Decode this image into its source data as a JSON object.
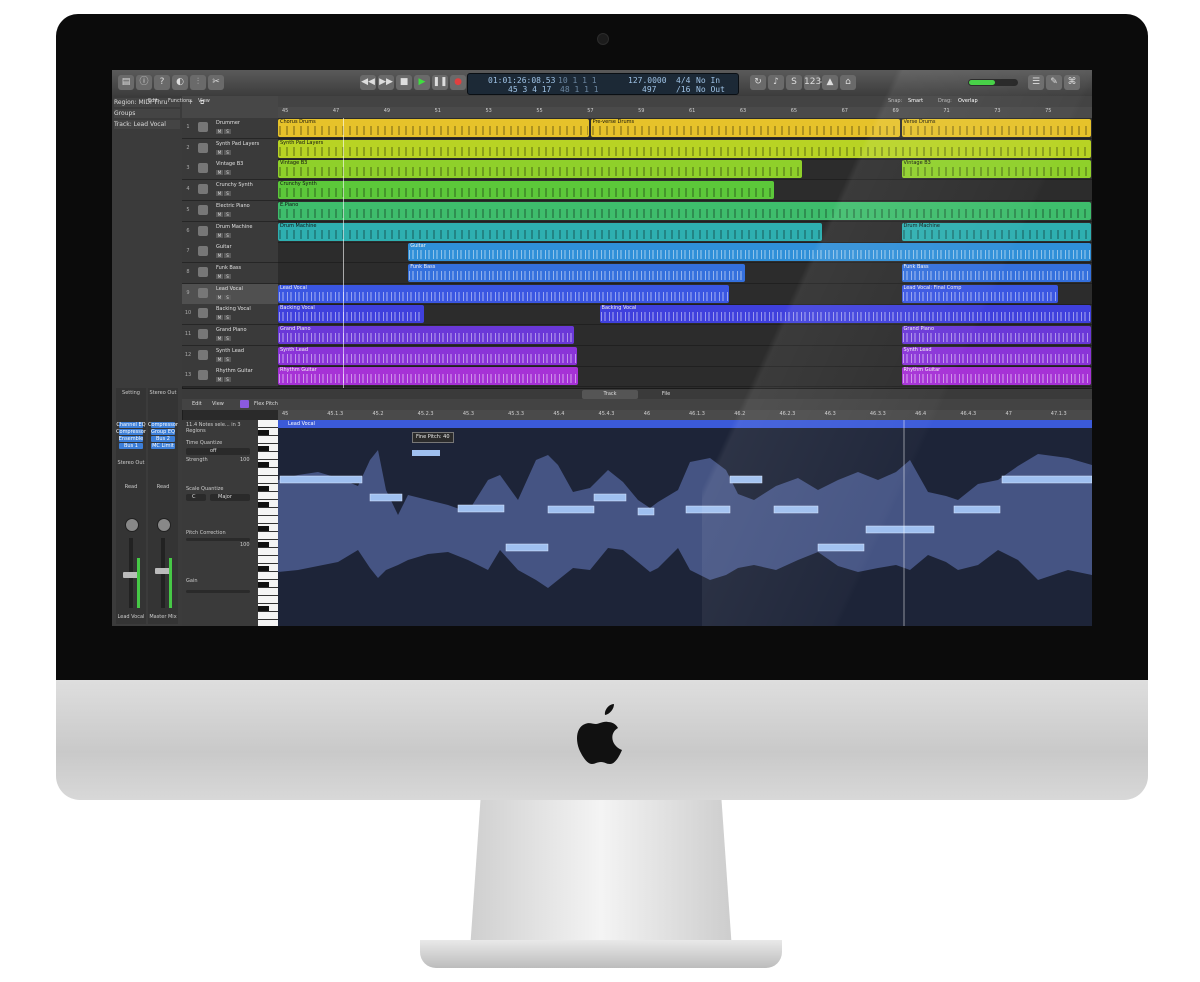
{
  "toolbar": {
    "lcd_position": "01:01:26:08.53",
    "lcd_bars": "10  1  1  1",
    "lcd_bars_row2": "45  3  4  17",
    "lcd_sub_row2": "48  1  1  1",
    "lcd_tempo": "127.0000",
    "lcd_sig": "4/4",
    "lcd_sig_row2": "/16",
    "lcd_key_row2": "497",
    "lcd_in": "No In",
    "lcd_out": "No Out"
  },
  "inspector": {
    "region_label": "Region: MIDI Thru",
    "groups_label": "Groups",
    "track_label": "Track: Lead Vocal",
    "strip_left": {
      "top": "Setting",
      "plugins": [
        "Channel EQ",
        "Compressor",
        "Ensemble",
        "Bus 1"
      ],
      "stereo": "Stereo Out",
      "read": "Read",
      "bottom": "Lead Vocal"
    },
    "strip_right": {
      "top": "Stereo Out",
      "plugins": [
        "Compressor",
        "Group EQ",
        "Bus 2",
        "MC Limit"
      ],
      "read": "Read",
      "bottom": "Master Mix"
    }
  },
  "arrange": {
    "menus": [
      "Edit",
      "Functions",
      "View"
    ],
    "snap_label": "Snap:",
    "snap_value": "Smart",
    "drag_label": "Drag:",
    "drag_value": "Overlap",
    "ruler": [
      "45",
      "47",
      "49",
      "51",
      "53",
      "55",
      "57",
      "59",
      "61",
      "63",
      "65",
      "67",
      "69",
      "71",
      "73",
      "75"
    ]
  },
  "tracks": [
    {
      "num": "1",
      "name": "Drummer",
      "color": "#e6c22a"
    },
    {
      "num": "2",
      "name": "Synth Pad Layers",
      "color": "#b8d324"
    },
    {
      "num": "3",
      "name": "Vintage B3",
      "color": "#8fd02a"
    },
    {
      "num": "4",
      "name": "Crunchy Synth",
      "color": "#5cc83a"
    },
    {
      "num": "5",
      "name": "Electric Piano",
      "color": "#3ebd6c"
    },
    {
      "num": "6",
      "name": "Drum Machine",
      "color": "#2eafb0"
    },
    {
      "num": "7",
      "name": "Guitar",
      "color": "#2f8fd8"
    },
    {
      "num": "8",
      "name": "Funk Bass",
      "color": "#3470dd"
    },
    {
      "num": "9",
      "name": "Lead Vocal",
      "color": "#3a56e2"
    },
    {
      "num": "10",
      "name": "Backing Vocal",
      "color": "#3f40dd"
    },
    {
      "num": "11",
      "name": "Grand Piano",
      "color": "#6a38d8"
    },
    {
      "num": "12",
      "name": "Synth Lead",
      "color": "#8a34d8"
    },
    {
      "num": "13",
      "name": "Rhythm Guitar",
      "color": "#a632d6"
    }
  ],
  "regions": [
    {
      "lane": 0,
      "kind": "midi",
      "name": "Chorus Drums",
      "start": 0,
      "end": 0.383
    },
    {
      "lane": 0,
      "kind": "midi",
      "name": "Pre-verse Drums",
      "start": 0.384,
      "end": 0.765
    },
    {
      "lane": 0,
      "kind": "midi",
      "name": "Verse Drums",
      "start": 0.766,
      "end": 1.0
    },
    {
      "lane": 1,
      "kind": "midi",
      "name": "Synth Pad Layers",
      "start": 0,
      "end": 1.0
    },
    {
      "lane": 2,
      "kind": "midi",
      "name": "Vintage B3",
      "start": 0,
      "end": 0.645
    },
    {
      "lane": 2,
      "kind": "midi",
      "name": "Vintage B3",
      "start": 0.766,
      "end": 1.0
    },
    {
      "lane": 3,
      "kind": "midi",
      "name": "Crunchy Synth",
      "start": 0,
      "end": 0.61
    },
    {
      "lane": 4,
      "kind": "midi",
      "name": "E.Piano",
      "start": 0,
      "end": 1.0
    },
    {
      "lane": 5,
      "kind": "midi",
      "name": "Drum Machine",
      "start": 0,
      "end": 0.67
    },
    {
      "lane": 5,
      "kind": "midi",
      "name": "Drum Machine",
      "start": 0.766,
      "end": 1.0
    },
    {
      "lane": 6,
      "kind": "audio",
      "name": "Guitar",
      "start": 0.16,
      "end": 1.0
    },
    {
      "lane": 7,
      "kind": "audio",
      "name": "Funk Bass",
      "start": 0.16,
      "end": 0.575
    },
    {
      "lane": 7,
      "kind": "audio",
      "name": "Funk Bass",
      "start": 0.766,
      "end": 1.0
    },
    {
      "lane": 8,
      "kind": "audio",
      "name": "Lead Vocal",
      "start": 0,
      "end": 0.555
    },
    {
      "lane": 8,
      "kind": "audio",
      "name": "Lead Vocal: Final Comp",
      "start": 0.766,
      "end": 0.96
    },
    {
      "lane": 9,
      "kind": "audio",
      "name": "Backing Vocal",
      "start": 0,
      "end": 0.18
    },
    {
      "lane": 9,
      "kind": "audio",
      "name": "Backing Vocal",
      "start": 0.395,
      "end": 1.0
    },
    {
      "lane": 10,
      "kind": "audio",
      "name": "Grand Piano",
      "start": 0,
      "end": 0.365
    },
    {
      "lane": 10,
      "kind": "audio",
      "name": "Grand Piano",
      "start": 0.766,
      "end": 1.0
    },
    {
      "lane": 11,
      "kind": "audio",
      "name": "Synth Lead",
      "start": 0,
      "end": 0.368
    },
    {
      "lane": 11,
      "kind": "audio",
      "name": "Synth Lead",
      "start": 0.766,
      "end": 1.0
    },
    {
      "lane": 12,
      "kind": "audio",
      "name": "Rhythm Guitar",
      "start": 0,
      "end": 0.37
    },
    {
      "lane": 12,
      "kind": "audio",
      "name": "Rhythm Guitar",
      "start": 0.766,
      "end": 1.0
    }
  ],
  "editor": {
    "tabs": [
      "Track",
      "File"
    ],
    "menus": [
      "Edit",
      "View"
    ],
    "mode": "Flex Pitch",
    "region_info": "11.4 Notes sele... in 3 Regions",
    "time_quantize_label": "Time Quantize",
    "time_quantize_value": "off",
    "strength_label": "Strength",
    "strength_value": "100",
    "scale_quantize_label": "Scale Quantize",
    "scale_key": "C",
    "scale_mode": "Major",
    "pitch_correction_label": "Pitch Correction",
    "pitch_correction_value": "100",
    "gain_label": "Gain",
    "region_name": "Lead Vocal",
    "tooltip": "Fine Pitch: 40",
    "ruler": [
      "45",
      "45.1.3",
      "45.2",
      "45.2.3",
      "45.3",
      "45.3.3",
      "45.4",
      "45.4.3",
      "46",
      "46.1.3",
      "46.2",
      "46.2.3",
      "46.3",
      "46.3.3",
      "46.4",
      "46.4.3",
      "47",
      "47.1.3"
    ]
  },
  "colors": {
    "flex_background": "#1d2438",
    "waveform": "#4a5a8c",
    "pitch_note": "#9fc0f0",
    "selected_header": "#3b5ad8"
  }
}
